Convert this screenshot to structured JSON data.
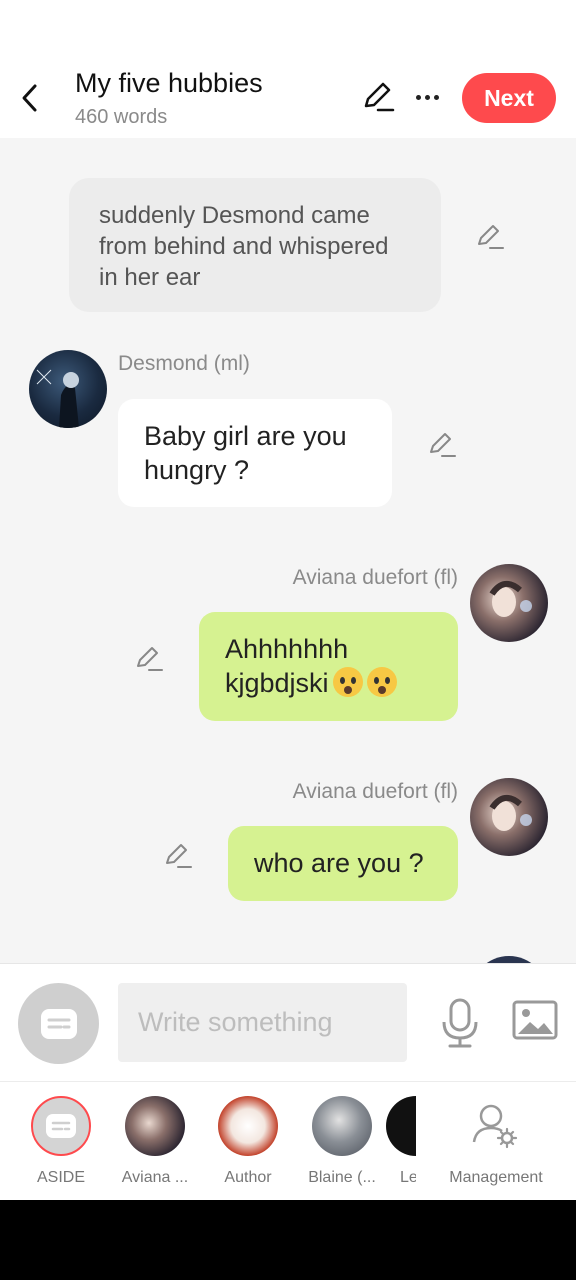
{
  "header": {
    "title": "My five hubbies",
    "word_count": "460 words",
    "next_label": "Next"
  },
  "messages": {
    "narration": "suddenly Desmond came from behind and whispered in her ear",
    "m1": {
      "sender": "Desmond (ml)",
      "text": "Baby girl are you hungry ?"
    },
    "m2": {
      "sender": "Aviana duefort (fl)",
      "text": "Ahhhhhhh kjgbdjski"
    },
    "m3": {
      "sender": "Aviana duefort (fl)",
      "text": "who are you ?"
    }
  },
  "composer": {
    "placeholder": "Write something"
  },
  "tabs": {
    "aside": "ASIDE",
    "aviana": "Aviana ...",
    "author": "Author",
    "blaine": "Blaine (...",
    "le": "Le",
    "management": "Management"
  },
  "colors": {
    "accent": "#fe4a4d",
    "user_bubble": "#d6f291",
    "other_bubble": "#ffffff",
    "narration_bubble": "#ececec"
  }
}
